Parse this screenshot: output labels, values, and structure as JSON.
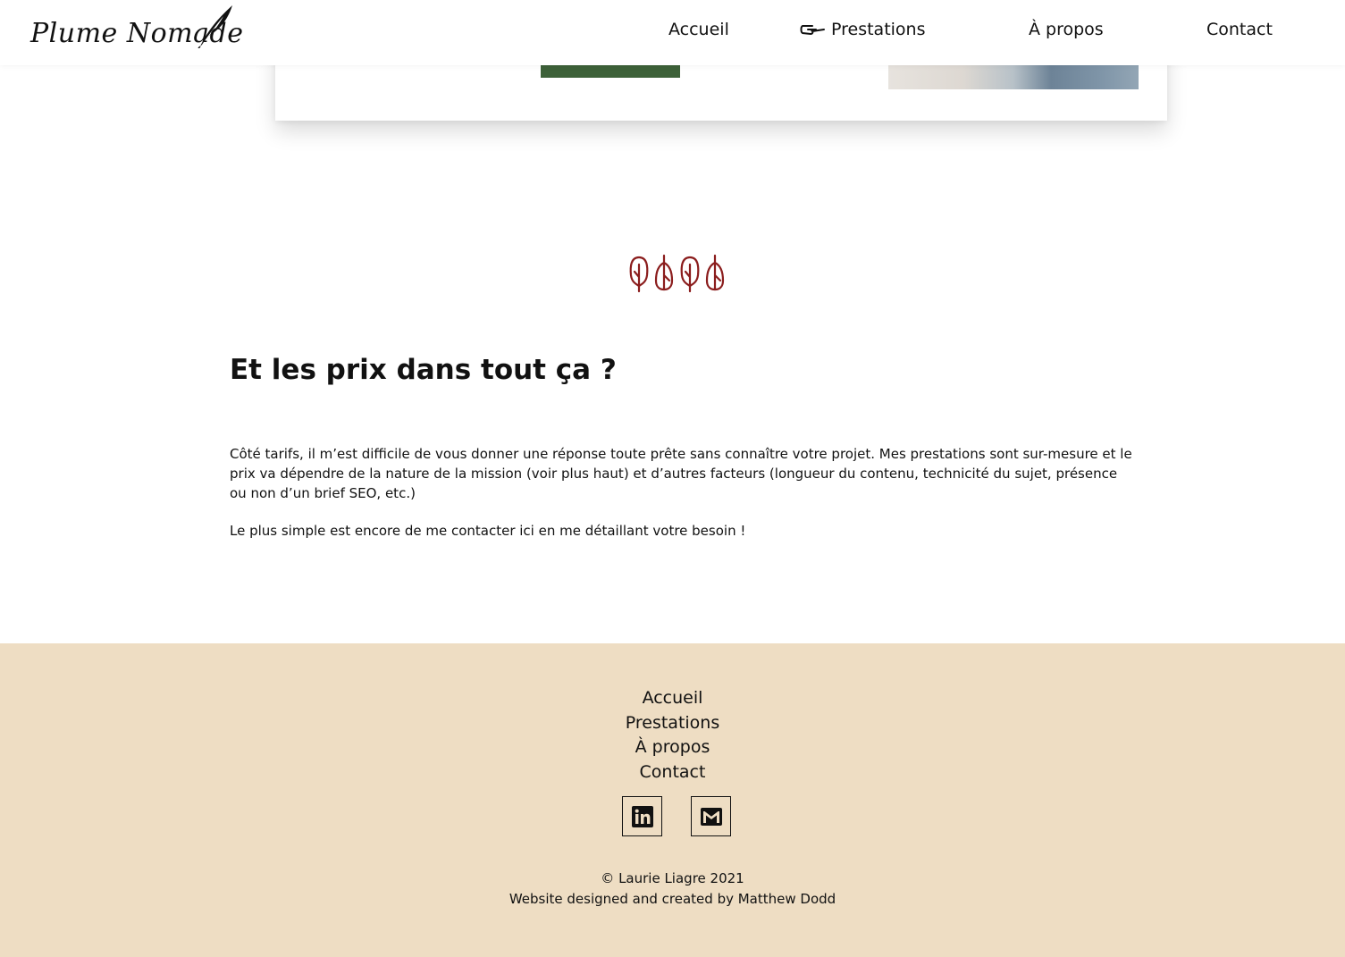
{
  "header": {
    "logo_text": "Plume Nomade",
    "nav": {
      "accueil": "Accueil",
      "prestations": "Prestations",
      "apropos": "À propos",
      "contact": "Contact"
    }
  },
  "colors": {
    "accent_green": "#3d6139",
    "feather_red": "#8b1d1d",
    "footer_bg": "#eeddc3"
  },
  "icons": {
    "prestations_nav": "pointing-hand-icon",
    "divider": "feathers-icon",
    "linkedin": "linkedin-icon",
    "mail": "gmail-icon"
  },
  "prices": {
    "title": "Et les prix dans tout ça ?",
    "paragraph_1": "Côté tarifs, il m’est difficile de vous donner une réponse toute prête sans connaître votre projet. Mes prestations sont sur-mesure et le prix va dépendre de la nature de la mission (voir plus haut) et d’autres facteurs (longueur du contenu, technicité du sujet, présence ou non d’un brief SEO, etc.)",
    "paragraph_2": "Le plus simple est encore de me contacter ici en me détaillant votre besoin !"
  },
  "footer": {
    "links": [
      "Accueil",
      "Prestations",
      "À propos",
      "Contact"
    ],
    "copyright": "© Laurie Liagre 2021",
    "credit": "Website designed and created by Matthew Dodd"
  }
}
